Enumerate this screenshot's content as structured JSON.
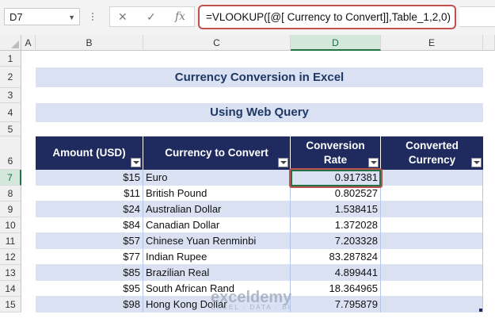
{
  "formula_bar": {
    "name_box": "D7",
    "cancel_icon": "✕",
    "enter_icon": "✓",
    "fx_label": "fx",
    "formula": "=VLOOKUP([@[ Currency to Convert]],Table_1,2,0)"
  },
  "columns": [
    "A",
    "B",
    "C",
    "D",
    "E"
  ],
  "rows": [
    "1",
    "2",
    "3",
    "4",
    "5",
    "6",
    "7",
    "8",
    "9",
    "10",
    "11",
    "12",
    "13",
    "14",
    "15"
  ],
  "title": "Currency Conversion in Excel",
  "subtitle": "Using Web Query",
  "table": {
    "headers": {
      "amount": "Amount (USD)",
      "currency": "Currency to Convert",
      "rate_line1": "Conversion",
      "rate_line2": "Rate",
      "converted_line1": "Converted",
      "converted_line2": "Currency"
    },
    "rows": [
      {
        "amount": "$15",
        "currency": "Euro",
        "rate": "0.917381",
        "converted": ""
      },
      {
        "amount": "$11",
        "currency": "British Pound",
        "rate": "0.802527",
        "converted": ""
      },
      {
        "amount": "$24",
        "currency": "Australian Dollar",
        "rate": "1.538415",
        "converted": ""
      },
      {
        "amount": "$84",
        "currency": "Canadian Dollar",
        "rate": "1.372028",
        "converted": ""
      },
      {
        "amount": "$57",
        "currency": "Chinese Yuan Renminbi",
        "rate": "7.203328",
        "converted": ""
      },
      {
        "amount": "$77",
        "currency": "Indian Rupee",
        "rate": "83.287824",
        "converted": ""
      },
      {
        "amount": "$85",
        "currency": "Brazilian Real",
        "rate": "4.899441",
        "converted": ""
      },
      {
        "amount": "$95",
        "currency": "South African Rand",
        "rate": "18.364965",
        "converted": ""
      },
      {
        "amount": "$98",
        "currency": "Hong Kong Dollar",
        "rate": "7.795879",
        "converted": ""
      }
    ]
  },
  "watermark": {
    "brand": "exceldemy",
    "tagline": "EXCEL · DATA · BI"
  },
  "colors": {
    "header_fill": "#1f2a5e",
    "band_fill": "#d9e1f2",
    "highlight": "#c0504d",
    "selection": "#217346"
  }
}
